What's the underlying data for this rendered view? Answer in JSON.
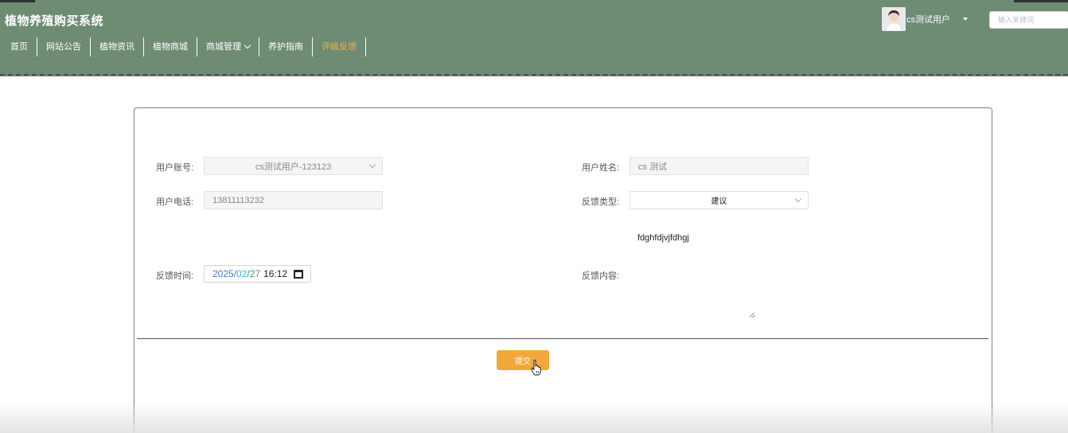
{
  "header": {
    "site_title": "植物养殖购买系统",
    "user_name": "cs测试用户",
    "search_placeholder": "输入关键词"
  },
  "nav": {
    "items": [
      {
        "label": "首页"
      },
      {
        "label": "网站公告"
      },
      {
        "label": "植物资讯"
      },
      {
        "label": "植物商城"
      },
      {
        "label": "商城管理"
      },
      {
        "label": "养护指南"
      },
      {
        "label": "评级反馈"
      }
    ],
    "active_index": 6
  },
  "form": {
    "account_label": "用户账号:",
    "account_value": "cs测试用户-123123",
    "name_label": "用户姓名:",
    "name_value": "cs 测试",
    "phone_label": "用户电话:",
    "phone_value": "13811113232",
    "type_label": "反馈类型:",
    "type_value": "建议",
    "time_label": "反馈时间:",
    "time_year": "2025",
    "time_month": "02",
    "time_day": "27",
    "time_clock": "16:12",
    "content_label": "反馈内容:",
    "content_value": "fdghfdjvjfdhgj",
    "submit_label": "提交"
  },
  "colors": {
    "header_bg": "#6e8b74",
    "active_nav": "#f0b04a",
    "submit_bg": "#f2a838"
  }
}
